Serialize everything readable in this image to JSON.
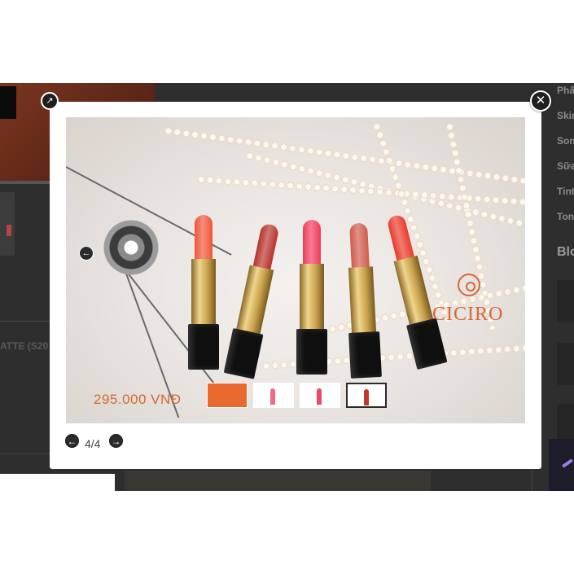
{
  "background_page": {
    "product_name_fragment": "ATTE (S20",
    "sidebar_categories": [
      "Phấ",
      "Skir",
      "Son",
      "Sữa",
      "Tint",
      "Ton"
    ],
    "sidebar_blog_heading": "Blo"
  },
  "lightbox": {
    "image_price_text": "295.000 VNĐ",
    "image_brand_text": "CICIRO",
    "counter_text": "4/4",
    "prev_icon": "arrow-left-icon",
    "next_icon": "arrow-right-icon",
    "close_icon": "close-icon",
    "expand_icon": "expand-icon",
    "thumbnails": [
      {
        "active": false,
        "color": "#e9692f"
      },
      {
        "active": false,
        "color": "#f06c86"
      },
      {
        "active": false,
        "color": "#e94a6a"
      },
      {
        "active": true,
        "color": "#c0392b"
      }
    ],
    "lipstick_colors": [
      "#ee5538",
      "#b8322a",
      "#ef3b5d",
      "#d05a4b",
      "#e93a2c"
    ]
  },
  "colors": {
    "overlay": "#2e2e2e",
    "brand": "#d9663a"
  }
}
